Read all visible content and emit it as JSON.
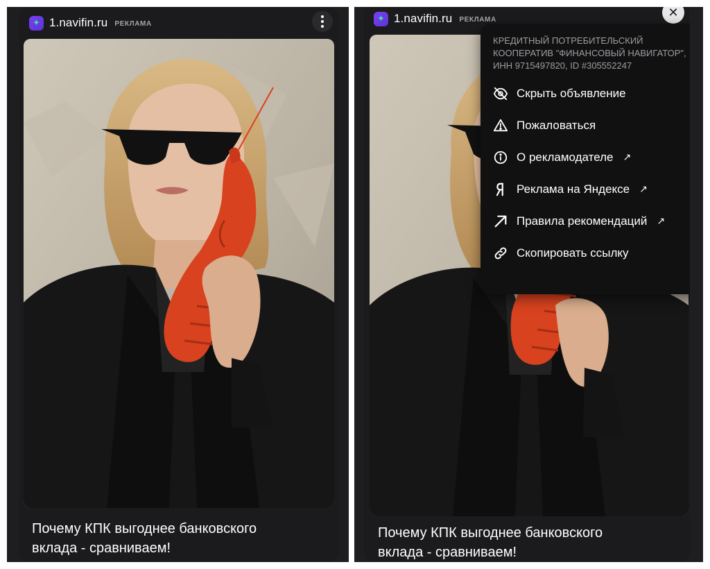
{
  "ad": {
    "domain": "1.navifin.ru",
    "label": "РЕКЛАМА",
    "headline": "Почему КПК выгоднее банковского\nвклада - сравниваем!"
  },
  "menu": {
    "advertiser": "КРЕДИТНЫЙ ПОТРЕБИТЕЛЬСКИЙ КООПЕРАТИВ \"ФИНАНСОВЫЙ НАВИГАТОР\", ИНН 9715497820, ID #305552247",
    "items": [
      {
        "label": "Скрыть объявление",
        "icon": "eye-off-icon",
        "external": false
      },
      {
        "label": "Пожаловаться",
        "icon": "warning-icon",
        "external": false
      },
      {
        "label": "О рекламодателе",
        "icon": "info-icon",
        "external": true
      },
      {
        "label": "Реклама на Яндексе",
        "icon": "yandex-icon",
        "external": true
      },
      {
        "label": "Правила рекомендаций",
        "icon": "arrow-icon",
        "external": true
      },
      {
        "label": "Скопировать ссылку",
        "icon": "link-icon",
        "external": false
      }
    ],
    "external_glyph": "↗"
  },
  "colors": {
    "card_bg": "#1b1b1d",
    "menu_bg": "#111112",
    "favicon": "#6a3ae8",
    "favicon_star": "#3fe0a0",
    "lobster": "#d8421f"
  },
  "glyphs": {
    "close": "✕",
    "favicon_star": "✦"
  }
}
